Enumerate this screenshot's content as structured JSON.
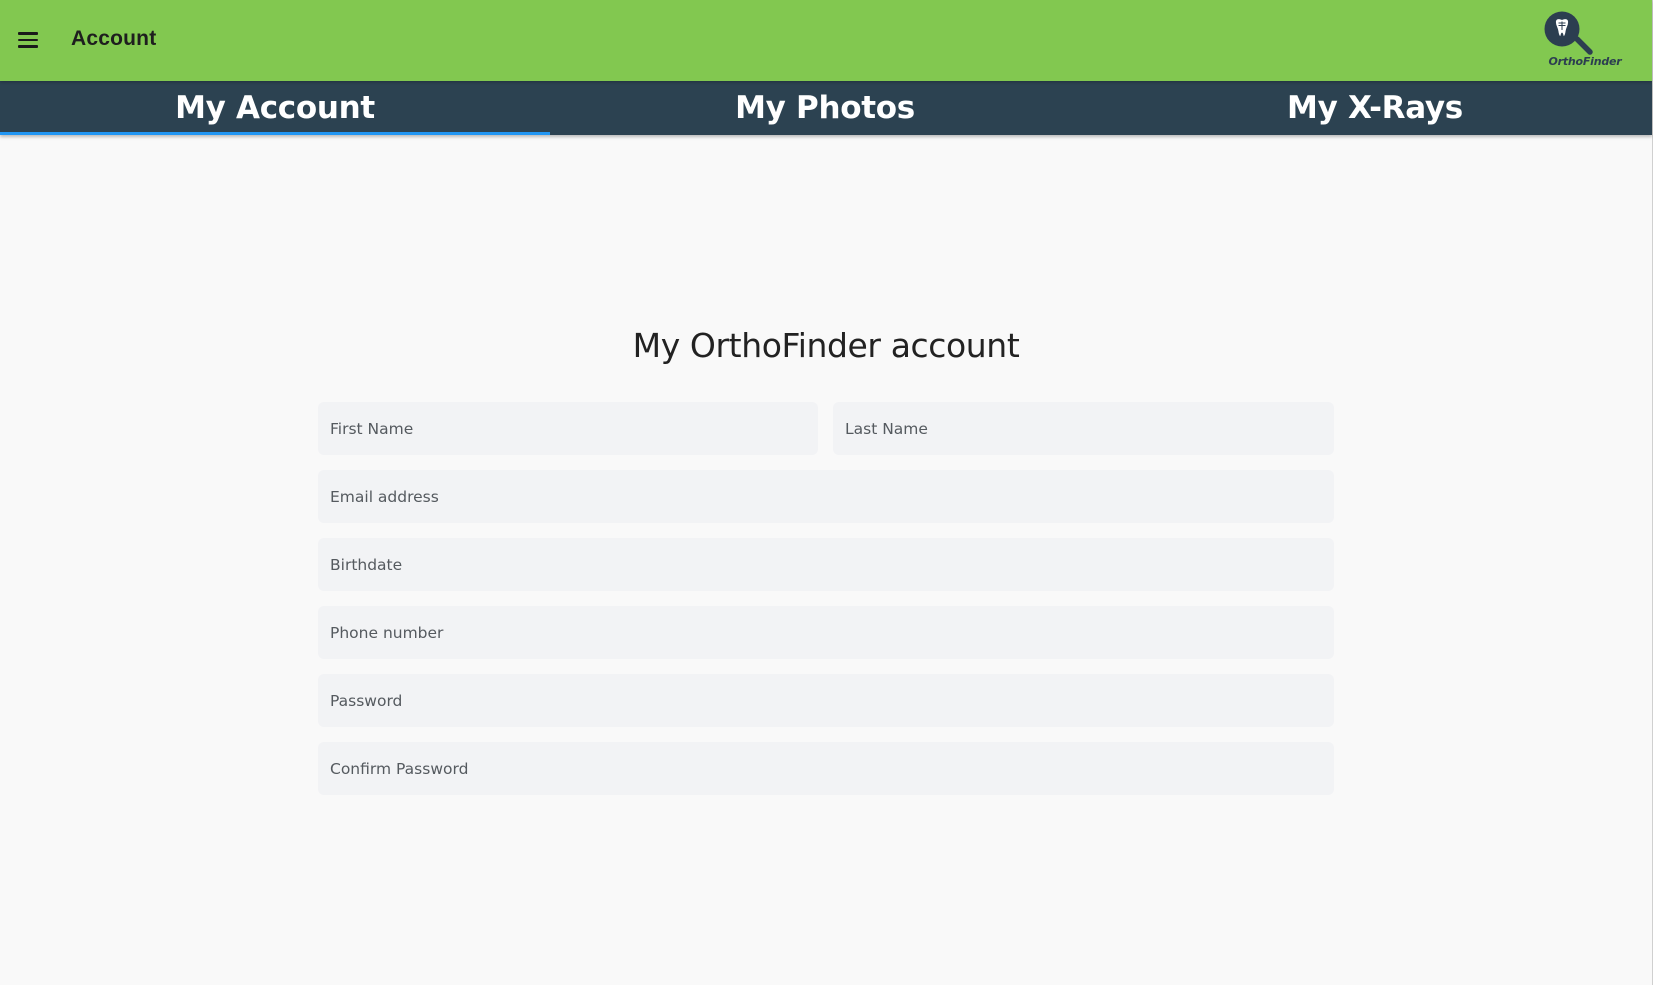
{
  "header": {
    "title": "Account",
    "menu_icon": "hamburger-menu-icon",
    "logo_text": "OrthoFinder",
    "logo_icon": "tooth-magnifier-logo",
    "bar_color": "#82c850"
  },
  "tabs": [
    {
      "label": "My Account",
      "selected": true
    },
    {
      "label": "My Photos",
      "selected": false
    },
    {
      "label": "My X-Rays",
      "selected": false
    }
  ],
  "tab_bar_color": "#2c4251",
  "tab_indicator_color": "#2196f3",
  "form": {
    "title": "My OrthoFinder account",
    "fields": {
      "first_name": {
        "placeholder": "First Name",
        "value": ""
      },
      "last_name": {
        "placeholder": "Last Name",
        "value": ""
      },
      "email": {
        "placeholder": "Email address",
        "value": ""
      },
      "birthdate": {
        "placeholder": "Birthdate",
        "value": ""
      },
      "phone": {
        "placeholder": "Phone number",
        "value": ""
      },
      "password": {
        "placeholder": "Password",
        "value": ""
      },
      "confirm_password": {
        "placeholder": "Confirm Password",
        "value": ""
      }
    }
  }
}
